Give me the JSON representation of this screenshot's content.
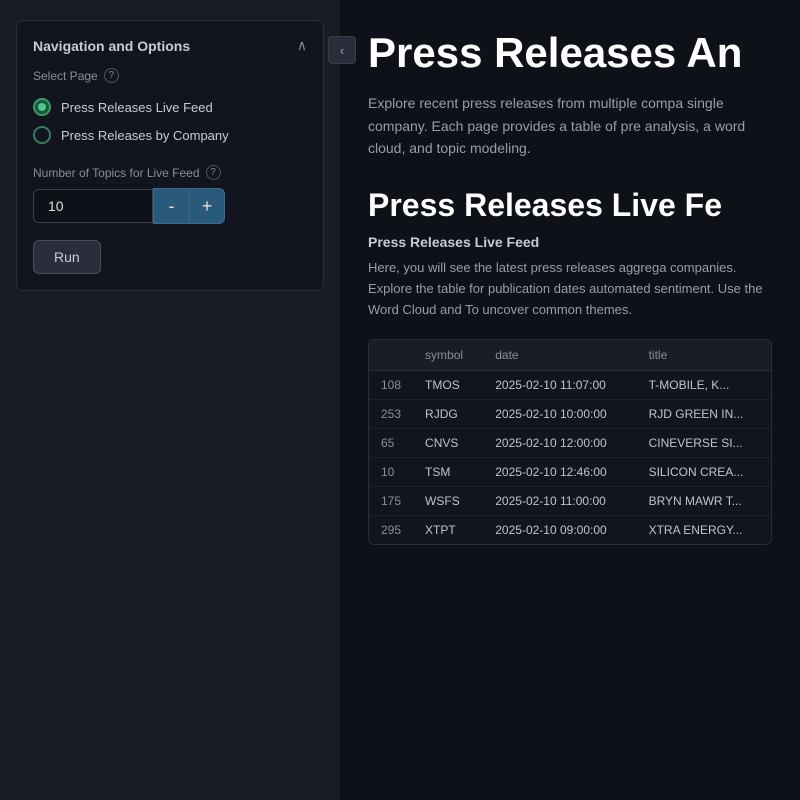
{
  "sidebar": {
    "collapse_label": "‹",
    "panel_title": "Navigation and Options",
    "panel_chevron": "∧",
    "select_page_label": "Select Page",
    "help_icon_label": "?",
    "pages": [
      {
        "id": "live-feed",
        "label": "Press Releases Live Feed",
        "active": true
      },
      {
        "id": "by-company",
        "label": "Press Releases by Company",
        "active": false
      }
    ],
    "topics_label": "Number of Topics for Live Feed",
    "topics_value": "10",
    "decrement_label": "-",
    "increment_label": "+",
    "run_label": "Run"
  },
  "main": {
    "heading": "Press Releases An",
    "description": "Explore recent press releases from multiple compa single company. Each page provides a table of pre analysis, a word cloud, and topic modeling.",
    "section_heading": "Press Releases Live Fe",
    "section_label": "Press Releases Live Feed",
    "section_desc": "Here, you will see the latest press releases aggrega companies. Explore the table for publication dates automated sentiment. Use the Word Cloud and To uncover common themes.",
    "table": {
      "columns": [
        "",
        "symbol",
        "date",
        "title"
      ],
      "rows": [
        {
          "id": "108",
          "symbol": "TMOS",
          "date": "2025-02-10 11:07:00",
          "title": "T-MOBILE, K..."
        },
        {
          "id": "253",
          "symbol": "RJDG",
          "date": "2025-02-10 10:00:00",
          "title": "RJD GREEN IN..."
        },
        {
          "id": "65",
          "symbol": "CNVS",
          "date": "2025-02-10 12:00:00",
          "title": "CINEVERSE SI..."
        },
        {
          "id": "10",
          "symbol": "TSM",
          "date": "2025-02-10 12:46:00",
          "title": "SILICON CREA..."
        },
        {
          "id": "175",
          "symbol": "WSFS",
          "date": "2025-02-10 11:00:00",
          "title": "BRYN MAWR T..."
        },
        {
          "id": "295",
          "symbol": "XTPT",
          "date": "2025-02-10 09:00:00",
          "title": "XTRA ENERGY..."
        }
      ]
    }
  }
}
